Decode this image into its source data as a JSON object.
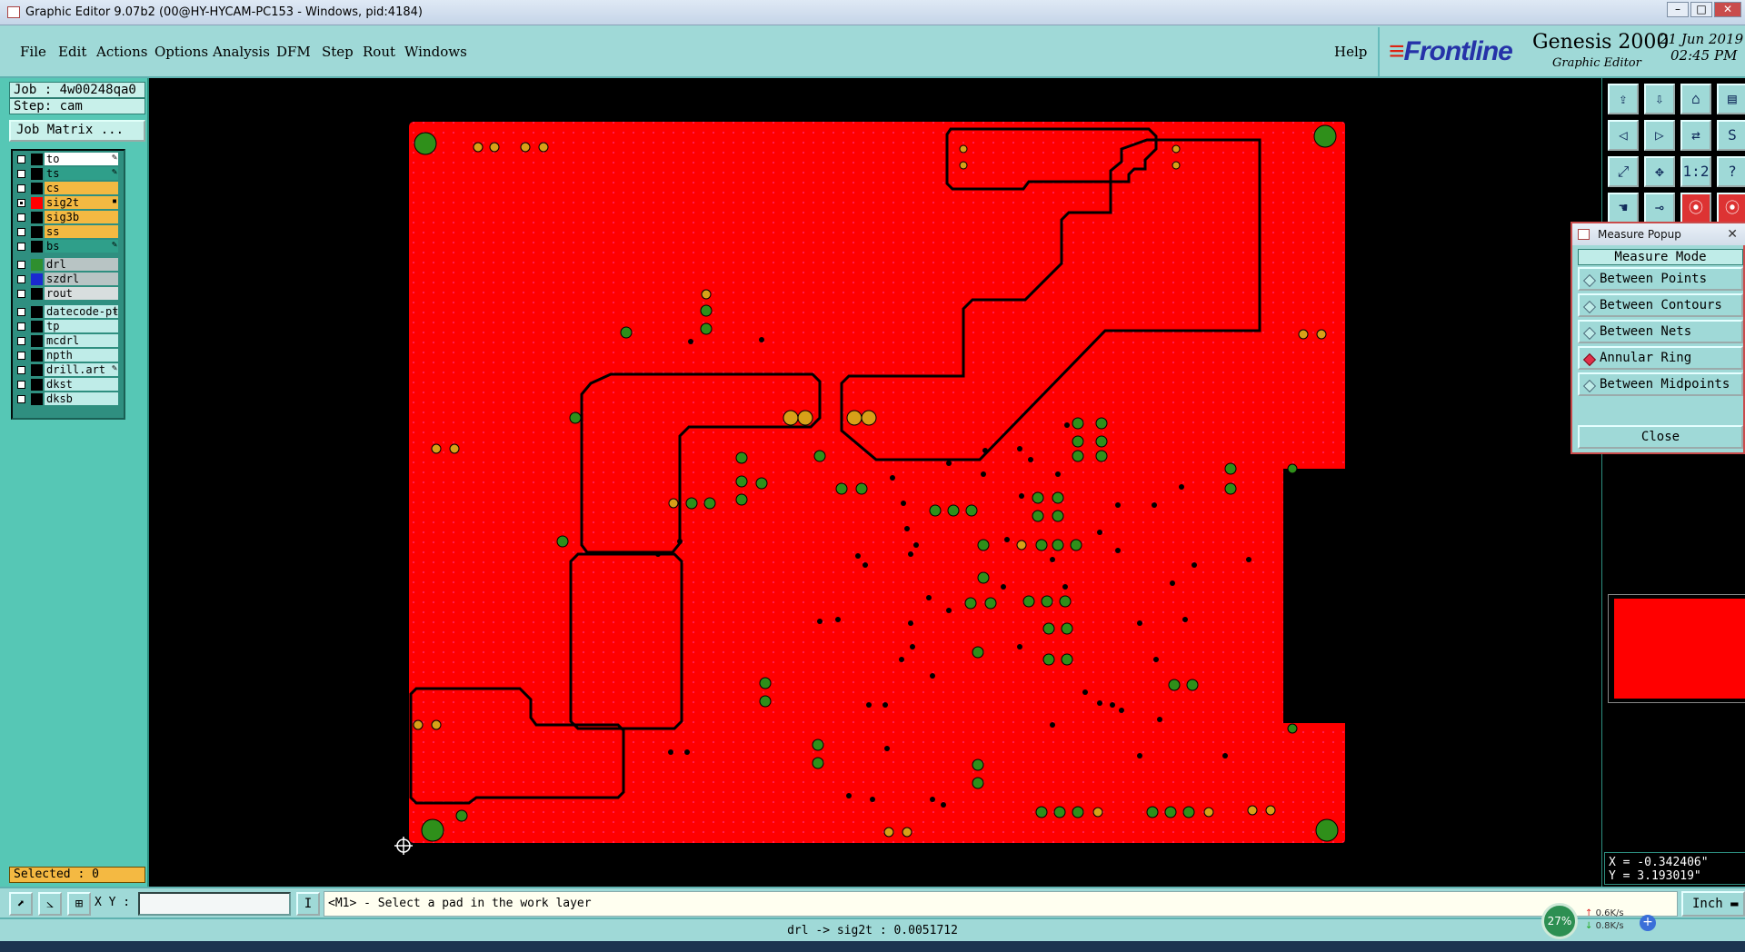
{
  "window": {
    "title": "Graphic Editor 9.07b2 (00@HY-HYCAM-PC153 - Windows, pid:4184)"
  },
  "menu": {
    "items": [
      "File",
      "Edit",
      "Actions",
      "Options",
      "Analysis",
      "DFM",
      "Step",
      "Rout",
      "Windows"
    ],
    "help": "Help"
  },
  "brand": {
    "logo": "Frontline",
    "product": "Genesis 2000",
    "subtitle": "Graphic Editor",
    "date": "21 Jun 2019",
    "time": "02:45 PM"
  },
  "job": {
    "job_label": "Job : 4w00248qa0",
    "step_label": "Step: cam",
    "matrix_button": "Job Matrix ..."
  },
  "layers": [
    {
      "name": "to",
      "bg": "#ffffff",
      "swatch": "#000000",
      "checked": false,
      "mark": "✎"
    },
    {
      "name": "ts",
      "bg": "#2f9f8a",
      "swatch": "#000000",
      "checked": false,
      "mark": "✎"
    },
    {
      "name": "cs",
      "bg": "#f4b942",
      "swatch": "#000000",
      "checked": false,
      "mark": ""
    },
    {
      "name": "sig2t",
      "bg": "#f4b942",
      "swatch": "#ff0000",
      "checked": true,
      "mark": "▪"
    },
    {
      "name": "sig3b",
      "bg": "#f4b942",
      "swatch": "#000000",
      "checked": false,
      "mark": ""
    },
    {
      "name": "ss",
      "bg": "#f4b942",
      "swatch": "#000000",
      "checked": false,
      "mark": ""
    },
    {
      "name": "bs",
      "bg": "#2f9f8a",
      "swatch": "#000000",
      "checked": false,
      "mark": "✎"
    },
    {
      "name": "drl",
      "bg": "#b8c4c4",
      "swatch": "#2f8f2f",
      "checked": false,
      "mark": ""
    },
    {
      "name": "szdrl",
      "bg": "#b8c4c4",
      "swatch": "#1a2ad0",
      "checked": false,
      "mark": ""
    },
    {
      "name": "rout",
      "bg": "#d8dede",
      "swatch": "#000000",
      "checked": false,
      "mark": ""
    },
    {
      "name": "datecode-pt",
      "bg": "#bfece8",
      "swatch": "#000000",
      "checked": false,
      "mark": "⤓"
    },
    {
      "name": "tp",
      "bg": "#bfece8",
      "swatch": "#000000",
      "checked": false,
      "mark": ""
    },
    {
      "name": "mcdrl",
      "bg": "#bfece8",
      "swatch": "#000000",
      "checked": false,
      "mark": ""
    },
    {
      "name": "npth",
      "bg": "#bfece8",
      "swatch": "#000000",
      "checked": false,
      "mark": ""
    },
    {
      "name": "drill.art",
      "bg": "#bfece8",
      "swatch": "#000000",
      "checked": false,
      "mark": "✎"
    },
    {
      "name": "dkst",
      "bg": "#bfece8",
      "swatch": "#000000",
      "checked": false,
      "mark": ""
    },
    {
      "name": "dksb",
      "bg": "#bfece8",
      "swatch": "#000000",
      "checked": false,
      "mark": ""
    }
  ],
  "selected": "Selected : 0",
  "toolbar": {
    "buttons": [
      "export-icon",
      "import-icon",
      "home-icon",
      "layout-icon",
      "prev-icon",
      "next-icon",
      "swap-icon",
      "s-icon",
      "zoom-fit-icon",
      "zoom-pan-icon",
      "ratio-icon",
      "help-icon",
      "hand-icon",
      "probe-icon",
      "snap-red-icon",
      "snap-red-icon-2"
    ],
    "ratio_label": "1:2",
    "help_label": "?"
  },
  "measure": {
    "title": "Measure Popup",
    "mode_label": "Measure Mode",
    "options": [
      {
        "label": "Between Points",
        "selected": false
      },
      {
        "label": "Between Contours",
        "selected": false
      },
      {
        "label": "Between Nets",
        "selected": false
      },
      {
        "label": "Annular Ring",
        "selected": true
      },
      {
        "label": "Between Midpoints",
        "selected": false
      }
    ],
    "close": "Close"
  },
  "coords": {
    "x": "X = -0.342406\"",
    "y": "Y = 3.193019\""
  },
  "command": {
    "xy_label": "X Y :",
    "xy_value": "",
    "prompt": "<M1> - Select a pad in the work layer",
    "unit": "Inch"
  },
  "status": "drl -> sig2t : 0.0051712",
  "network": {
    "percent": "27%",
    "up": "0.6K/s",
    "down": "0.8K/s"
  },
  "colors": {
    "copper": "#ff0000",
    "pad_green": "#2f8f1a",
    "pad_orange": "#d8a018",
    "panel": "#9fd9d7"
  }
}
